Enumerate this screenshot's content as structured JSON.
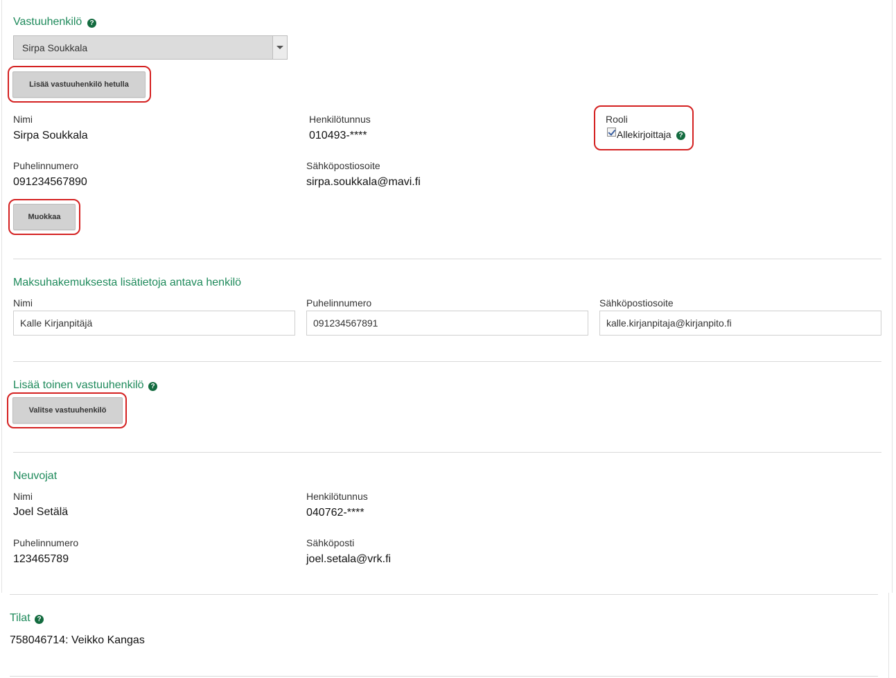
{
  "responsible": {
    "title": "Vastuuhenkilö",
    "select_value": "Sirpa Soukkala",
    "add_by_ssn_button": "Lisää vastuuhenkilö hetulla",
    "name_label": "Nimi",
    "name_value": "Sirpa Soukkala",
    "ssn_label": "Henkilötunnus",
    "ssn_value": "010493-****",
    "role_label": "Rooli",
    "role_option": "Allekirjoittaja",
    "phone_label": "Puhelinnumero",
    "phone_value": "091234567890",
    "email_label": "Sähköpostiosoite",
    "email_value": "sirpa.soukkala@mavi.fi",
    "edit_button": "Muokkaa"
  },
  "contact": {
    "title": "Maksuhakemuksesta lisätietoja antava henkilö",
    "name_label": "Nimi",
    "name_value": "Kalle Kirjanpitäjä",
    "phone_label": "Puhelinnumero",
    "phone_value": "091234567891",
    "email_label": "Sähköpostiosoite",
    "email_value": "kalle.kirjanpitaja@kirjanpito.fi"
  },
  "second_responsible": {
    "title": "Lisää toinen vastuuhenkilö",
    "choose_button": "Valitse vastuuhenkilö"
  },
  "advisors": {
    "title": "Neuvojat",
    "name_label": "Nimi",
    "name_value": "Joel Setälä",
    "ssn_label": "Henkilötunnus",
    "ssn_value": "040762-****",
    "phone_label": "Puhelinnumero",
    "phone_value": "123465789",
    "email_label": "Sähköposti",
    "email_value": "joel.setala@vrk.fi"
  },
  "farms": {
    "title": "Tilat",
    "item": "758046714: Veikko Kangas"
  },
  "help_glyph": "?",
  "colors": {
    "heading": "#1e8a5b",
    "help_icon": "#136b3f",
    "highlight": "#d42020"
  }
}
